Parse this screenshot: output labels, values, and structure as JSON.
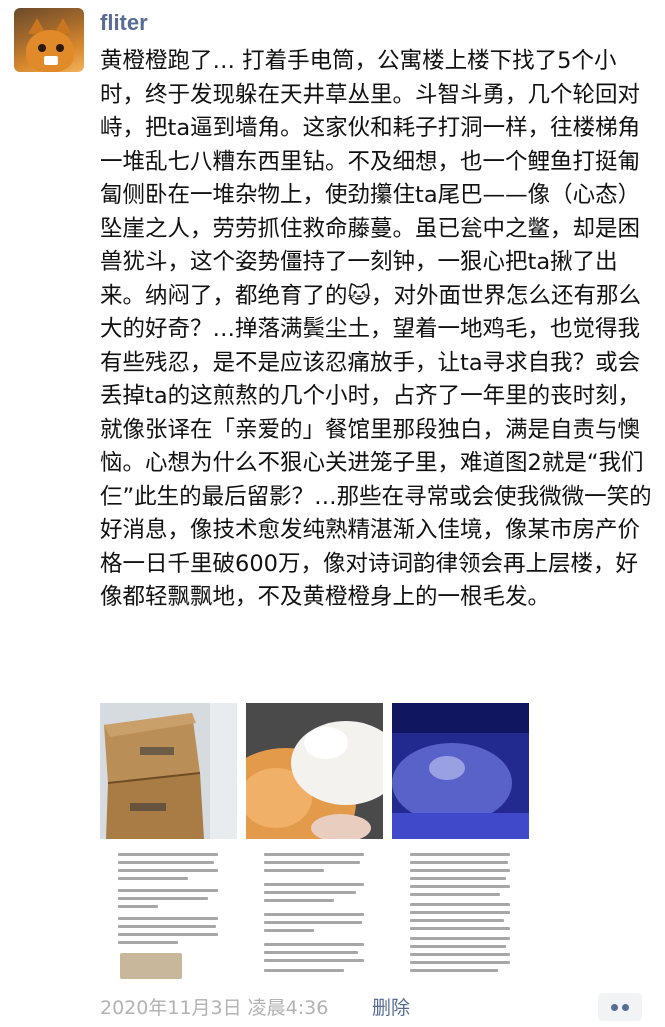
{
  "post": {
    "username": "fliter",
    "text": "黄橙橙跑了… 打着手电筒，公寓楼上楼下找了5个小时，终于发现躲在天井草丛里。斗智斗勇，几个轮回对峙，把ta逼到墙角。这家伙和耗子打洞一样，往楼梯角一堆乱七八糟东西里钻。不及细想，也一个鲤鱼打挺匍匐侧卧在一堆杂物上，使劲攥住ta尾巴——像（心态）坠崖之人，劳劳抓住救命藤蔓。虽已瓮中之鳖，却是困兽犹斗，这个姿势僵持了一刻钟，一狠心把ta揪了出来。纳闷了，都绝育了的🐱，对外面世界怎么还有那么大的好奇？…掸落满鬓尘土，望着一地鸡毛，也觉得我有些残忍，是不是应该忍痛放手，让ta寻求自我？或会丢掉ta的这煎熬的几个小时，占齐了一年里的丧时刻，就像张译在「亲爱的」餐馆里那段独白，满是自责与懊恼。心想为什么不狠心关进笼子里，难道图2就是“我们仨”此生的最后留影？…那些在寻常或会使我微微一笑的好消息，像技术愈发纯熟精湛渐入佳境，像某市房产价格一日千里破600万，像对诗词韵律领会再上层楼，好像都轻飘飘地，不及黄橙橙身上的一根毛发。",
    "timestamp": "2020年11月3日 凌晨4:36",
    "delete_label": "删除",
    "images": [
      {
        "icon": "cardboard-boxes-photo"
      },
      {
        "icon": "two-cats-photo"
      },
      {
        "icon": "cat-under-blue-light-photo"
      },
      {
        "icon": "text-screenshot-photo"
      },
      {
        "icon": "text-screenshot-photo"
      },
      {
        "icon": "text-screenshot-photo"
      }
    ]
  },
  "colors": {
    "name_link": "#576b95",
    "body_text": "#111111",
    "meta_gray": "#b2b2b2",
    "more_button_bg": "#f2f3f5"
  }
}
